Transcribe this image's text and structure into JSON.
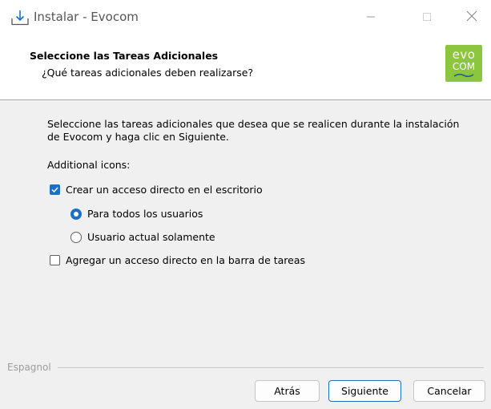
{
  "window": {
    "title": "Instalar - Evocom"
  },
  "header": {
    "title": "Seleccione las Tareas Adicionales",
    "subtitle": "¿Qué tareas adicionales deben realizarse?",
    "logo": {
      "line1": "evo",
      "line2": "COM",
      "color": "#8cc63f"
    }
  },
  "body": {
    "description": "Seleccione las tareas adicionales que desea que se realicen durante la instalación de Evocom y haga clic en Siguiente.",
    "group_label": "Additional icons:",
    "options": {
      "desktop_shortcut": {
        "label": "Crear un acceso directo en el escritorio",
        "checked": true
      },
      "all_users": {
        "label": "Para todos los usuarios",
        "selected": true
      },
      "current_user": {
        "label": "Usuario actual solamente",
        "selected": false
      },
      "taskbar_shortcut": {
        "label": "Agregar un acceso directo en la barra de tareas",
        "checked": false
      }
    }
  },
  "footer": {
    "language_label": "Espagnol",
    "back_label": "Atrás",
    "next_label": "Siguiente",
    "cancel_label": "Cancelar"
  },
  "colors": {
    "accent": "#1c6fc7",
    "logo_green": "#8cc63f"
  }
}
